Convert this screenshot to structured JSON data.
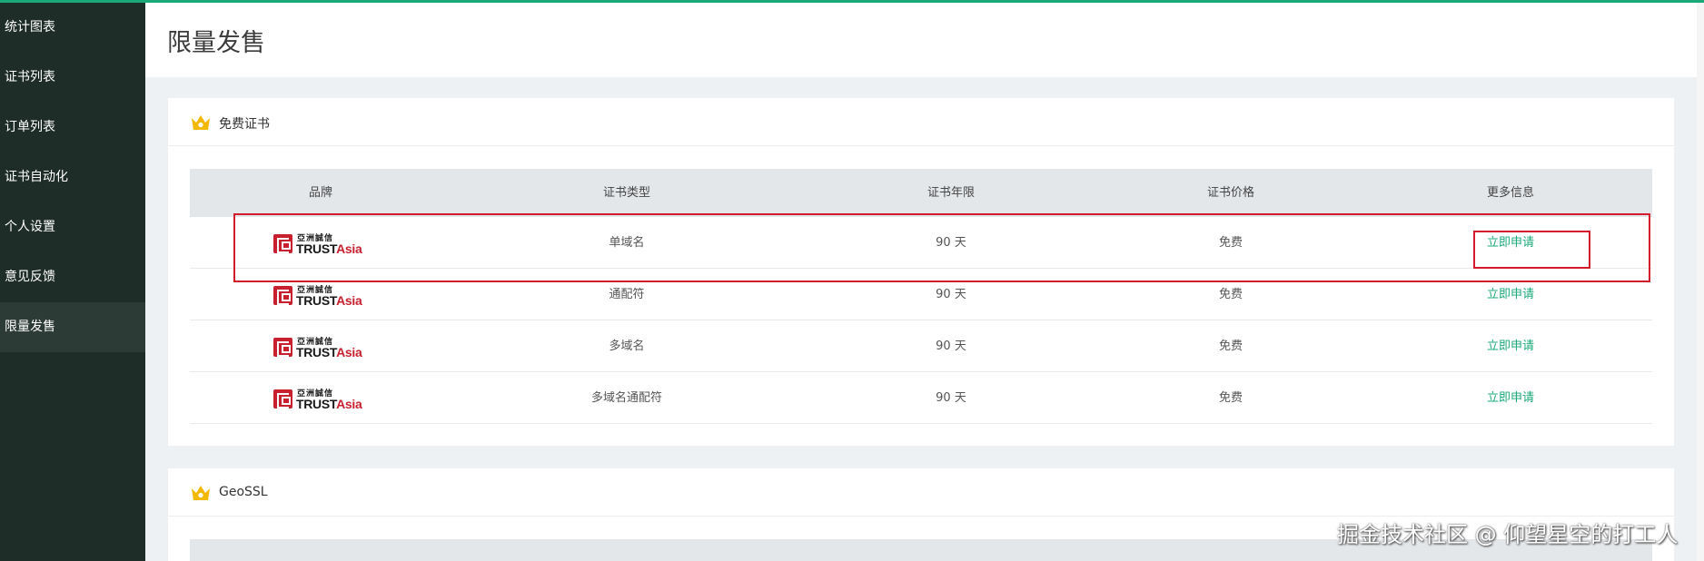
{
  "sidebar": {
    "items": [
      {
        "label": "统计图表"
      },
      {
        "label": "证书列表"
      },
      {
        "label": "订单列表"
      },
      {
        "label": "证书自动化"
      },
      {
        "label": "个人设置"
      },
      {
        "label": "意见反馈"
      },
      {
        "label": "限量发售",
        "active": true
      }
    ]
  },
  "page": {
    "title": "限量发售"
  },
  "free_section": {
    "title": "免费证书",
    "icon": "crown-icon",
    "columns": [
      "品牌",
      "证书类型",
      "证书年限",
      "证书价格",
      "更多信息"
    ],
    "rows": [
      {
        "brand_cn": "亞洲誠信",
        "brand_en_a": "TRUST",
        "brand_en_b": "Asia",
        "type": "单域名",
        "years": "90 天",
        "price": "免费",
        "action": "立即申请"
      },
      {
        "brand_cn": "亞洲誠信",
        "brand_en_a": "TRUST",
        "brand_en_b": "Asia",
        "type": "通配符",
        "years": "90 天",
        "price": "免费",
        "action": "立即申请"
      },
      {
        "brand_cn": "亞洲誠信",
        "brand_en_a": "TRUST",
        "brand_en_b": "Asia",
        "type": "多域名",
        "years": "90 天",
        "price": "免费",
        "action": "立即申请"
      },
      {
        "brand_cn": "亞洲誠信",
        "brand_en_a": "TRUST",
        "brand_en_b": "Asia",
        "type": "多域名通配符",
        "years": "90 天",
        "price": "免费",
        "action": "立即申请"
      }
    ]
  },
  "geossl_section": {
    "title": "GeoSSL",
    "icon": "crown-icon"
  },
  "watermark": "掘金技术社区 @ 仰望星空的打工人",
  "colors": {
    "accent": "#1aa877",
    "sidebar_bg": "#1f2d29",
    "highlight": "#d41b2c"
  }
}
